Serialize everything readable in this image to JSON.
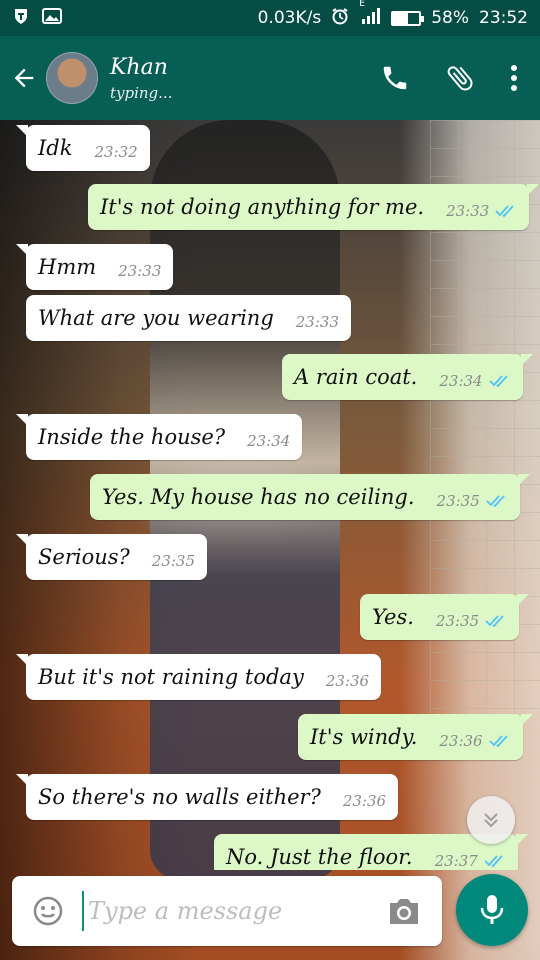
{
  "status_bar": {
    "network_speed": "0.03K/s",
    "signal_label": "E",
    "battery": "58%",
    "battery_level": 0.58,
    "time": "23:52"
  },
  "header": {
    "contact_name": "Khan",
    "contact_status": "typing..."
  },
  "messages": [
    {
      "text": "Idk",
      "time": "23:32",
      "direction": "incoming"
    },
    {
      "text": "It's not doing anything for me.",
      "time": "23:33",
      "direction": "outgoing"
    },
    {
      "text": "Hmm",
      "time": "23:33",
      "direction": "incoming"
    },
    {
      "text": "What are you wearing",
      "time": "23:33",
      "direction": "incoming"
    },
    {
      "text": "A rain coat.",
      "time": "23:34",
      "direction": "outgoing"
    },
    {
      "text": "Inside the house?",
      "time": "23:34",
      "direction": "incoming"
    },
    {
      "text": "Yes. My house has no ceiling.",
      "time": "23:35",
      "direction": "outgoing"
    },
    {
      "text": "Serious?",
      "time": "23:35",
      "direction": "incoming"
    },
    {
      "text": "Yes.",
      "time": "23:35",
      "direction": "outgoing"
    },
    {
      "text": "But it's not raining today",
      "time": "23:36",
      "direction": "incoming"
    },
    {
      "text": "It's windy.",
      "time": "23:36",
      "direction": "outgoing"
    },
    {
      "text": "So there's no walls either?",
      "time": "23:36",
      "direction": "incoming"
    },
    {
      "text": "No. Just the floor.",
      "time": "23:37",
      "direction": "outgoing"
    }
  ],
  "input": {
    "placeholder": "Type a message",
    "value": ""
  },
  "colors": {
    "status_bar": "#054d44",
    "app_bar": "#075e54",
    "outgoing_bubble": "#dcf8c6",
    "incoming_bubble": "#ffffff",
    "read_ticks": "#4fc3f7",
    "mic_button": "#00897b"
  },
  "icons": {
    "back": "arrow-left-icon",
    "call": "phone-icon",
    "attach": "paperclip-icon",
    "menu": "more-vertical-icon",
    "emoji": "smiley-icon",
    "camera": "camera-icon",
    "mic": "mic-icon",
    "scroll": "chevron-double-down-icon"
  }
}
